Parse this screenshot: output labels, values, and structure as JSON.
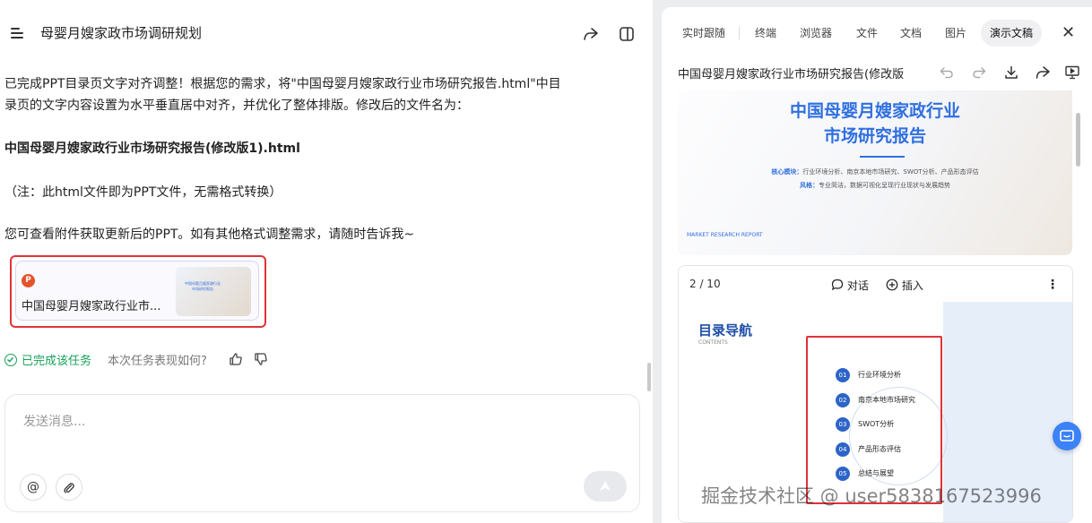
{
  "header": {
    "title": "母婴月嫂家政市场调研规划"
  },
  "messages": {
    "line1": "已完成PPT目录页文字对齐调整！根据您的需求，将\"中国母婴月嫂家政行业市场研究报告.html\"中目",
    "line2": "录页的文字内容设置为水平垂直居中对齐，并优化了整体排版。修改后的文件名为：",
    "filename": "中国母婴月嫂家政行业市场研究报告(修改版1).html",
    "note": "（注：此html文件即为PPT文件，无需格式转换）",
    "closing": "您可查看附件获取更新后的PPT。如有其他格式调整需求，请随时告诉我~"
  },
  "attachment": {
    "name": "中国母婴月嫂家政行业市...",
    "thumb_title": "中国母婴月嫂家政行业\n市场研究报告"
  },
  "status": {
    "done": "已完成该任务",
    "ask": "本次任务表现如何?"
  },
  "input": {
    "placeholder": "发送消息..."
  },
  "tabs": [
    "实时跟随",
    "终端",
    "浏览器",
    "文件",
    "文档",
    "图片",
    "演示文稿"
  ],
  "document": {
    "title": "中国母婴月嫂家政行业市场研究报告(修改版"
  },
  "slide1": {
    "title1": "中国母婴月嫂家政行业",
    "title2": "市场研究报告",
    "module_label": "核心模块：",
    "module_text": "行业环境分析、南京本地市场研究、SWOT分析、产品形态评估",
    "style_label": "风格：",
    "style_text": "专业简洁，数据可视化呈现行业现状与发展趋势",
    "footer": "MARKET RESEARCH REPORT"
  },
  "card": {
    "page": "2 / 10",
    "dialog": "对话",
    "insert": "插入"
  },
  "slide2": {
    "title": "目录导航",
    "subtitle": "CONTENTS",
    "items": [
      {
        "num": "01",
        "label": "行业环境分析"
      },
      {
        "num": "02",
        "label": "南京本地市场研究"
      },
      {
        "num": "03",
        "label": "SWOT分析"
      },
      {
        "num": "04",
        "label": "产品形态评估"
      },
      {
        "num": "05",
        "label": "总结与展望"
      }
    ]
  },
  "watermark": "掘金技术社区 @ user5838167523996",
  "colors": {
    "accent": "#2f6fe0",
    "success": "#18a058",
    "highlight": "#e0323a"
  }
}
